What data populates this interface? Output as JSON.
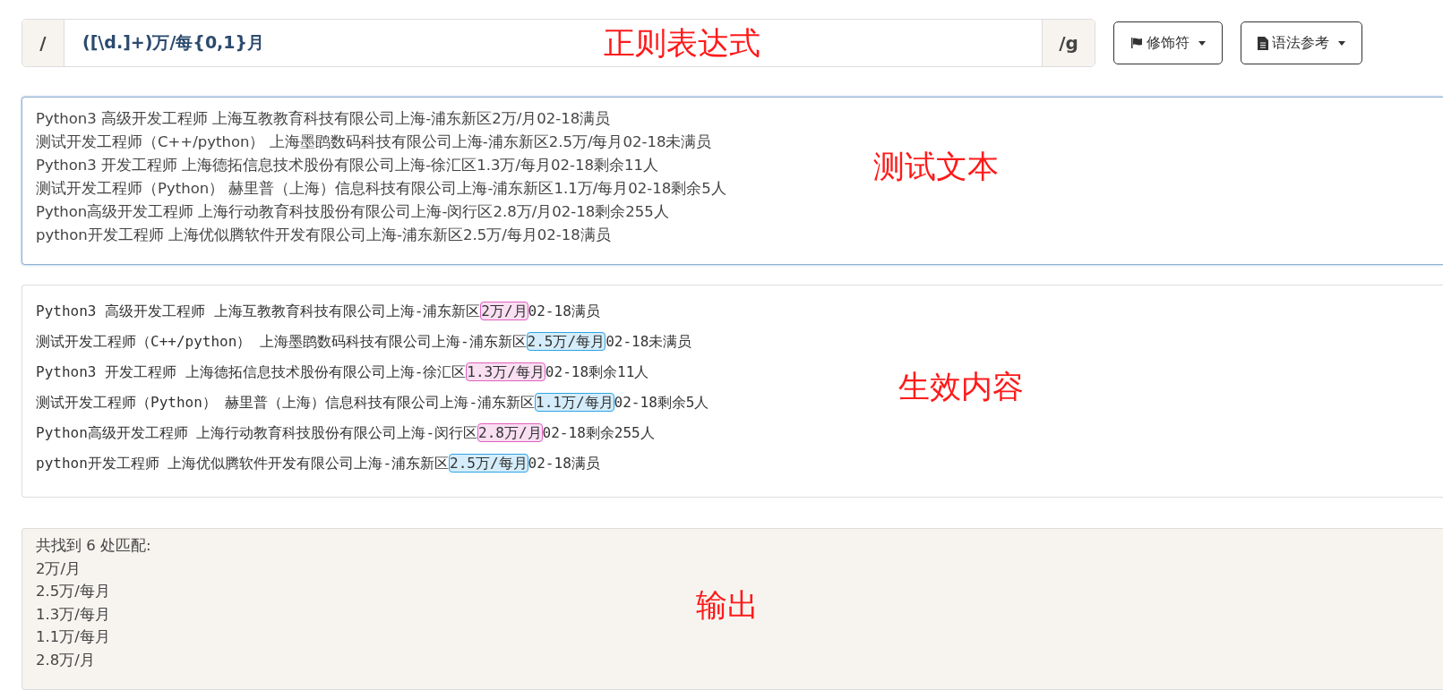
{
  "regex": {
    "prefix": "/",
    "pattern": "([\\d.]+)万/每{0,1}月",
    "suffix": "/g"
  },
  "toolbar": [
    {
      "label": "修饰符",
      "kind": "flag"
    },
    {
      "label": "语法参考",
      "kind": "document"
    }
  ],
  "test_text": [
    "Python3 高级开发工程师 上海互教教育科技有限公司上海-浦东新区2万/月02-18满员",
    "测试开发工程师（C++/python） 上海墨鹍数码科技有限公司上海-浦东新区2.5万/每月02-18未满员",
    "Python3 开发工程师 上海德拓信息技术股份有限公司上海-徐汇区1.3万/每月02-18剩余11人",
    "测试开发工程师（Python） 赫里普（上海）信息科技有限公司上海-浦东新区1.1万/每月02-18剩余5人",
    "Python高级开发工程师 上海行动教育科技股份有限公司上海-闵行区2.8万/月02-18剩余255人",
    "python开发工程师 上海优似腾软件开发有限公司上海-浦东新区2.5万/每月02-18满员"
  ],
  "results": [
    {
      "before": "Python3 高级开发工程师 上海互教教育科技有限公司上海-浦东新区",
      "match": "2万/月",
      "after": "02-18满员",
      "color": "#e060c0"
    },
    {
      "before": "测试开发工程师（C++/python） 上海墨鹍数码科技有限公司上海-浦东新区",
      "match": "2.5万/每月",
      "after": "02-18未满员",
      "color": "#2fa4e7"
    },
    {
      "before": "Python3 开发工程师 上海德拓信息技术股份有限公司上海-徐汇区",
      "match": "1.3万/每月",
      "after": "02-18剩余11人",
      "color": "#e060c0"
    },
    {
      "before": "测试开发工程师（Python） 赫里普（上海）信息科技有限公司上海-浦东新区",
      "match": "1.1万/每月",
      "after": "02-18剩余5人",
      "color": "#2fa4e7"
    },
    {
      "before": "Python高级开发工程师 上海行动教育科技股份有限公司上海-闵行区",
      "match": "2.8万/月",
      "after": "02-18剩余255人",
      "color": "#e060c0"
    },
    {
      "before": "python开发工程师 上海优似腾软件开发有限公司上海-浦东新区",
      "match": "2.5万/每月",
      "after": "02-18满员",
      "color": "#2fa4e7"
    }
  ],
  "output": [
    "共找到 6 处匹配:",
    "2万/月",
    "2.5万/每月",
    "1.3万/每月",
    "1.1万/每月",
    "2.8万/月"
  ],
  "annotations": [
    "正则表达式",
    "测试文本",
    "生效内容",
    "输出"
  ]
}
